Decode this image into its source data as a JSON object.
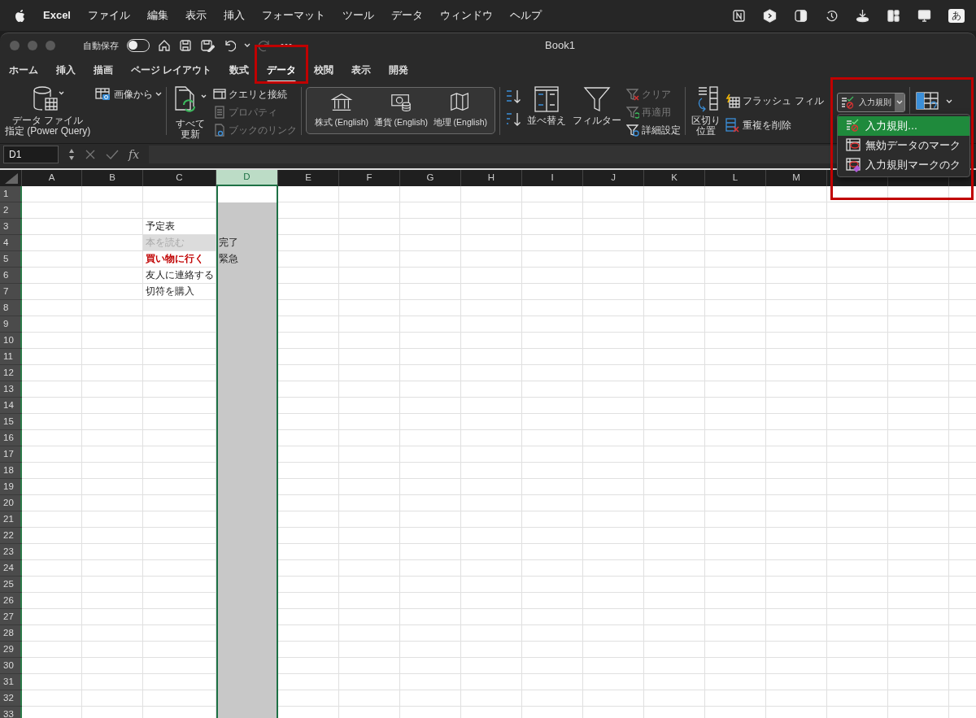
{
  "menu_bar": {
    "app": "Excel",
    "items": [
      "ファイル",
      "編集",
      "表示",
      "挿入",
      "フォーマット",
      "ツール",
      "データ",
      "ウィンドウ",
      "ヘルプ"
    ],
    "input_method": "あ"
  },
  "window": {
    "title": "Book1",
    "autosave": {
      "label": "自動保存",
      "on": false
    }
  },
  "ribbon_tabs": [
    {
      "label": "ホーム",
      "selected": false
    },
    {
      "label": "挿入",
      "selected": false
    },
    {
      "label": "描画",
      "selected": false
    },
    {
      "label": "ページ レイアウト",
      "selected": false
    },
    {
      "label": "数式",
      "selected": false
    },
    {
      "label": "データ",
      "selected": true
    },
    {
      "label": "校閲",
      "selected": false
    },
    {
      "label": "表示",
      "selected": false
    },
    {
      "label": "開発",
      "selected": false
    }
  ],
  "ribbon": {
    "get_data": [
      "データ ファイル",
      "指定 (Power Query)"
    ],
    "from_picture": "画像から",
    "refresh_all": [
      "すべて",
      "更新"
    ],
    "queries": [
      {
        "label": "クエリと接続",
        "disabled": false
      },
      {
        "label": "プロパティ",
        "disabled": true
      },
      {
        "label": "ブックのリンク",
        "disabled": true
      }
    ],
    "data_types": [
      "株式 (English)",
      "通貨 (English)",
      "地理 (English)"
    ],
    "sort": "並べ替え",
    "filter": "フィルター",
    "filter_options": [
      {
        "label": "クリア",
        "disabled": true
      },
      {
        "label": "再適用",
        "disabled": true
      },
      {
        "label": "詳細設定",
        "disabled": false
      }
    ],
    "text_to_columns": [
      "区切り",
      "位置"
    ],
    "data_tools": [
      "フラッシュ フィル",
      "重複を削除"
    ],
    "validation": {
      "label": "入力規則",
      "expanded": true
    }
  },
  "validation_menu": [
    {
      "label": "入力規則…",
      "selected": true
    },
    {
      "label": "無効データのマーク",
      "selected": false
    },
    {
      "label": "入力規則マークのク",
      "selected": false
    }
  ],
  "formula_bar": {
    "name_box": "D1",
    "function_label": "fx"
  },
  "sheet": {
    "columns": [
      {
        "label": "A",
        "selected": false
      },
      {
        "label": "B",
        "selected": false
      },
      {
        "label": "C",
        "selected": false
      },
      {
        "label": "D",
        "selected": true
      },
      {
        "label": "E",
        "selected": false
      },
      {
        "label": "F",
        "selected": false
      },
      {
        "label": "G",
        "selected": false
      },
      {
        "label": "H",
        "selected": false
      },
      {
        "label": "I",
        "selected": false
      },
      {
        "label": "J",
        "selected": false
      },
      {
        "label": "K",
        "selected": false
      },
      {
        "label": "L",
        "selected": false
      },
      {
        "label": "M",
        "selected": false
      }
    ],
    "rows": [
      {
        "label": "1"
      },
      {
        "label": "2"
      },
      {
        "label": "3",
        "cells": {
          "C": {
            "text": "予定表",
            "kind": "plain"
          }
        }
      },
      {
        "label": "4",
        "cells": {
          "C": {
            "text": "本を読む",
            "kind": "done"
          },
          "D": {
            "text": "完了",
            "kind": "plain"
          }
        }
      },
      {
        "label": "5",
        "cells": {
          "C": {
            "text": "買い物に行く",
            "kind": "urgent"
          },
          "D": {
            "text": "緊急",
            "kind": "plain"
          }
        }
      },
      {
        "label": "6",
        "cells": {
          "C": {
            "text": "友人に連絡する",
            "kind": "plain"
          }
        }
      },
      {
        "label": "7",
        "cells": {
          "C": {
            "text": "切符を購入",
            "kind": "plain"
          }
        }
      },
      {
        "label": "8"
      },
      {
        "label": "9"
      },
      {
        "label": "10"
      },
      {
        "label": "11"
      },
      {
        "label": "12"
      },
      {
        "label": "13"
      },
      {
        "label": "14"
      },
      {
        "label": "15"
      },
      {
        "label": "16"
      },
      {
        "label": "17"
      },
      {
        "label": "18"
      },
      {
        "label": "19"
      },
      {
        "label": "20"
      },
      {
        "label": "21"
      },
      {
        "label": "22"
      },
      {
        "label": "23"
      },
      {
        "label": "24"
      },
      {
        "label": "25"
      },
      {
        "label": "26"
      },
      {
        "label": "27"
      },
      {
        "label": "28"
      },
      {
        "label": "29"
      },
      {
        "label": "30"
      },
      {
        "label": "31"
      },
      {
        "label": "32"
      },
      {
        "label": "33"
      }
    ]
  }
}
